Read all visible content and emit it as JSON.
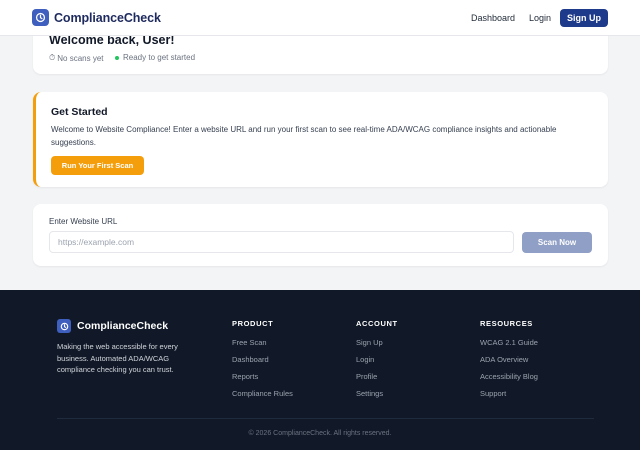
{
  "nav": {
    "brand": "ComplianceCheck",
    "logo_icon": "clock-icon",
    "links": [
      "Dashboard",
      "Login"
    ],
    "signup_label": "Sign Up"
  },
  "welcome": {
    "title": "Welcome back, User!",
    "status_scans": "No scans yet",
    "status_ready": "Ready to get started"
  },
  "get_started": {
    "title": "Get Started",
    "description": "Welcome to Website Compliance! Enter a website URL and run your first scan to see real-time ADA/WCAG compliance insights and actionable suggestions.",
    "button_label": "Run Your First Scan"
  },
  "url_form": {
    "label": "Enter Website URL",
    "placeholder": "https://example.com",
    "value": "",
    "scan_label": "Scan Now"
  },
  "footer": {
    "brand": "ComplianceCheck",
    "description": "Making the web accessible for every business. Automated ADA/WCAG compliance checking you can trust.",
    "columns": [
      {
        "title": "PRODUCT",
        "links": [
          "Free Scan",
          "Dashboard",
          "Reports",
          "Compliance Rules"
        ]
      },
      {
        "title": "ACCOUNT",
        "links": [
          "Sign Up",
          "Login",
          "Profile",
          "Settings"
        ]
      },
      {
        "title": "RESOURCES",
        "links": [
          "WCAG 2.1 Guide",
          "ADA Overview",
          "Accessibility Blog",
          "Support"
        ]
      }
    ],
    "copyright": "© 2026 ComplianceCheck. All rights reserved."
  },
  "colors": {
    "brand_navy": "#1e3a8a",
    "accent_amber": "#f59e0b",
    "status_green": "#22c55e",
    "footer_bg": "#111827"
  }
}
